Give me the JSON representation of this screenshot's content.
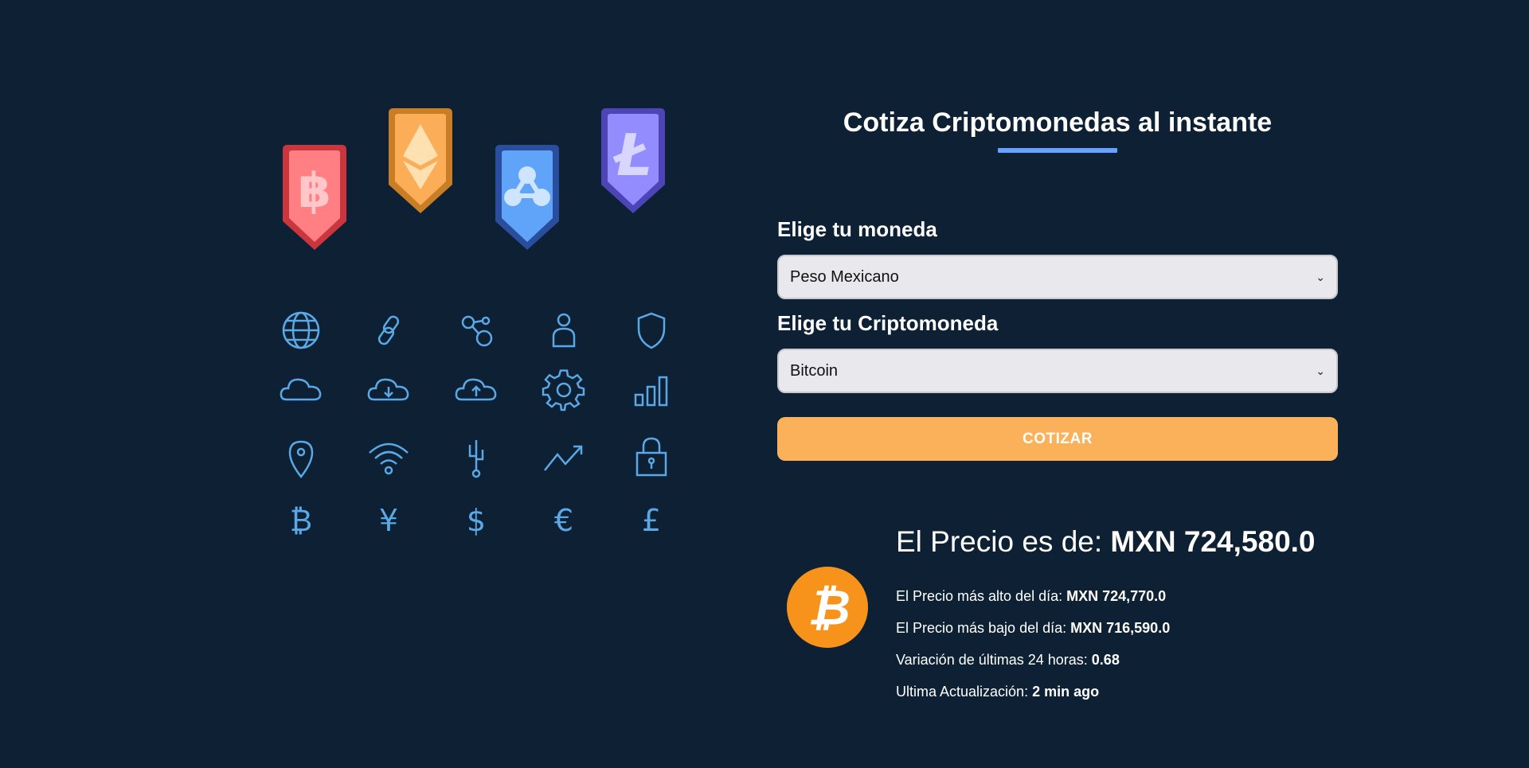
{
  "header": {
    "title": "Cotiza Criptomonedas al instante"
  },
  "form": {
    "currency_label": "Elige tu moneda",
    "currency_selected": "Peso Mexicano",
    "crypto_label": "Elige tu Criptomoneda",
    "crypto_selected": "Bitcoin",
    "submit_label": "COTIZAR"
  },
  "result": {
    "price_label": "El Precio es de: ",
    "price_value": "MXN 724,580.0",
    "high_label": "El Precio más alto del día: ",
    "high_value": "MXN 724,770.0",
    "low_label": "El Precio más bajo del día: ",
    "low_value": "MXN 716,590.0",
    "change_label": "Variación de últimas 24 horas: ",
    "change_value": "0.68",
    "updated_label": "Ultima Actualización: ",
    "updated_value": "2 min ago",
    "coin_icon": "bitcoin-icon"
  },
  "illustration": {
    "badges": [
      "bitcoin-badge",
      "ethereum-badge",
      "ripple-badge",
      "litecoin-badge"
    ],
    "icons": [
      "globe-icon",
      "link-icon",
      "network-icon",
      "user-icon",
      "shield-icon",
      "cloud-icon",
      "cloud-download-icon",
      "cloud-upload-icon",
      "gear-icon",
      "bar-chart-icon",
      "map-pin-icon",
      "wifi-icon",
      "usb-icon",
      "trend-up-icon",
      "lock-icon",
      "bitcoin-icon",
      "yen-icon",
      "dollar-icon",
      "euro-icon",
      "pound-icon"
    ]
  },
  "colors": {
    "background": "#0d2034",
    "accent_blue": "#66a2fe",
    "button_orange": "#fbb05a",
    "icon_blue": "#5aa9e6",
    "bitcoin_orange": "#f7931a"
  }
}
